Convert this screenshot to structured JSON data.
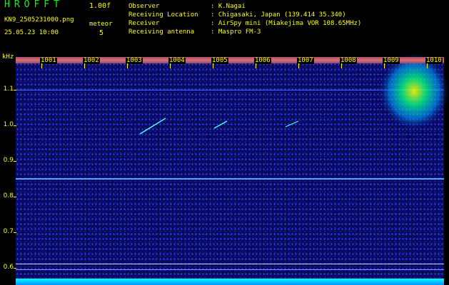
{
  "header": {
    "app_title": "HROFFT",
    "version": "1.00f",
    "file_name": "KN9_2505231000.png",
    "datetime": "25.05.23 10:00",
    "meteor_label": "meteor",
    "meteor_count": "5"
  },
  "info": [
    {
      "label": "Observer",
      "value": ": K.Nagai"
    },
    {
      "label": "Receiving Location",
      "value": ": Chigasaki, Japan (139.414 35.340)"
    },
    {
      "label": "Receiver",
      "value": ": AirSpy mini (Miakejima VOR 108.65MHz)"
    },
    {
      "label": "Receiving antenna",
      "value": ": Maspro FM-3"
    }
  ],
  "axis": {
    "unit": "kHz",
    "y_ticks": [
      "1.1",
      "1.0",
      "0.9",
      "0.8",
      "0.7",
      "0.6"
    ],
    "minute_labels": [
      "1001",
      "1002",
      "1003",
      "1004",
      "1005",
      "1006",
      "1007",
      "1008",
      "1009",
      "1010"
    ]
  },
  "colors": {
    "label": "#ffff00",
    "title": "#00ff00",
    "background": "#0a0a5e",
    "signal": "#00ffff"
  }
}
